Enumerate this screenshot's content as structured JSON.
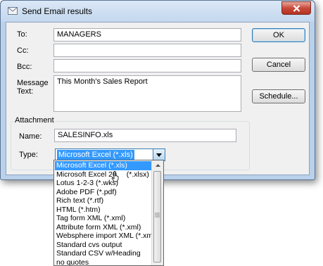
{
  "window": {
    "title": "Send Email results"
  },
  "fields": {
    "to_label": "To:",
    "to_value": "MANAGERS",
    "cc_label": "Cc:",
    "cc_value": "",
    "bcc_label": "Bcc:",
    "bcc_value": "",
    "message_label_1": "Message",
    "message_label_2": "Text:",
    "message_value": "This Month's Sales Report"
  },
  "buttons": {
    "ok": "OK",
    "cancel": "Cancel",
    "schedule": "Schedule..."
  },
  "attachment": {
    "group_label": "Attachment",
    "name_label": "Name:",
    "name_value": "SALESINFO.xls",
    "type_label": "Type:",
    "type_selected": "Microsoft Excel  (*.xls)"
  },
  "type_options": [
    "Microsoft Excel  (*.xls)",
    "Microsoft Excel 20",
    "Lotus 1-2-3  (*.wks)",
    "Adobe PDF  (*.pdf)",
    "Rich text  (*.rtf)",
    "HTML  (*.htm)",
    "Tag form XML  (*.xml)",
    "Attribute form XML  (*.xml)",
    "Websphere import XML  (*.xml)",
    "Standard cvs output",
    "Standard CSV w/Heading",
    "no quotes"
  ],
  "type_option_1_suffix": "(*.xlsx)",
  "colors": {
    "selection": "#3399ff",
    "close_button": "#c8493a",
    "window_frame": "#b9d1ea"
  }
}
